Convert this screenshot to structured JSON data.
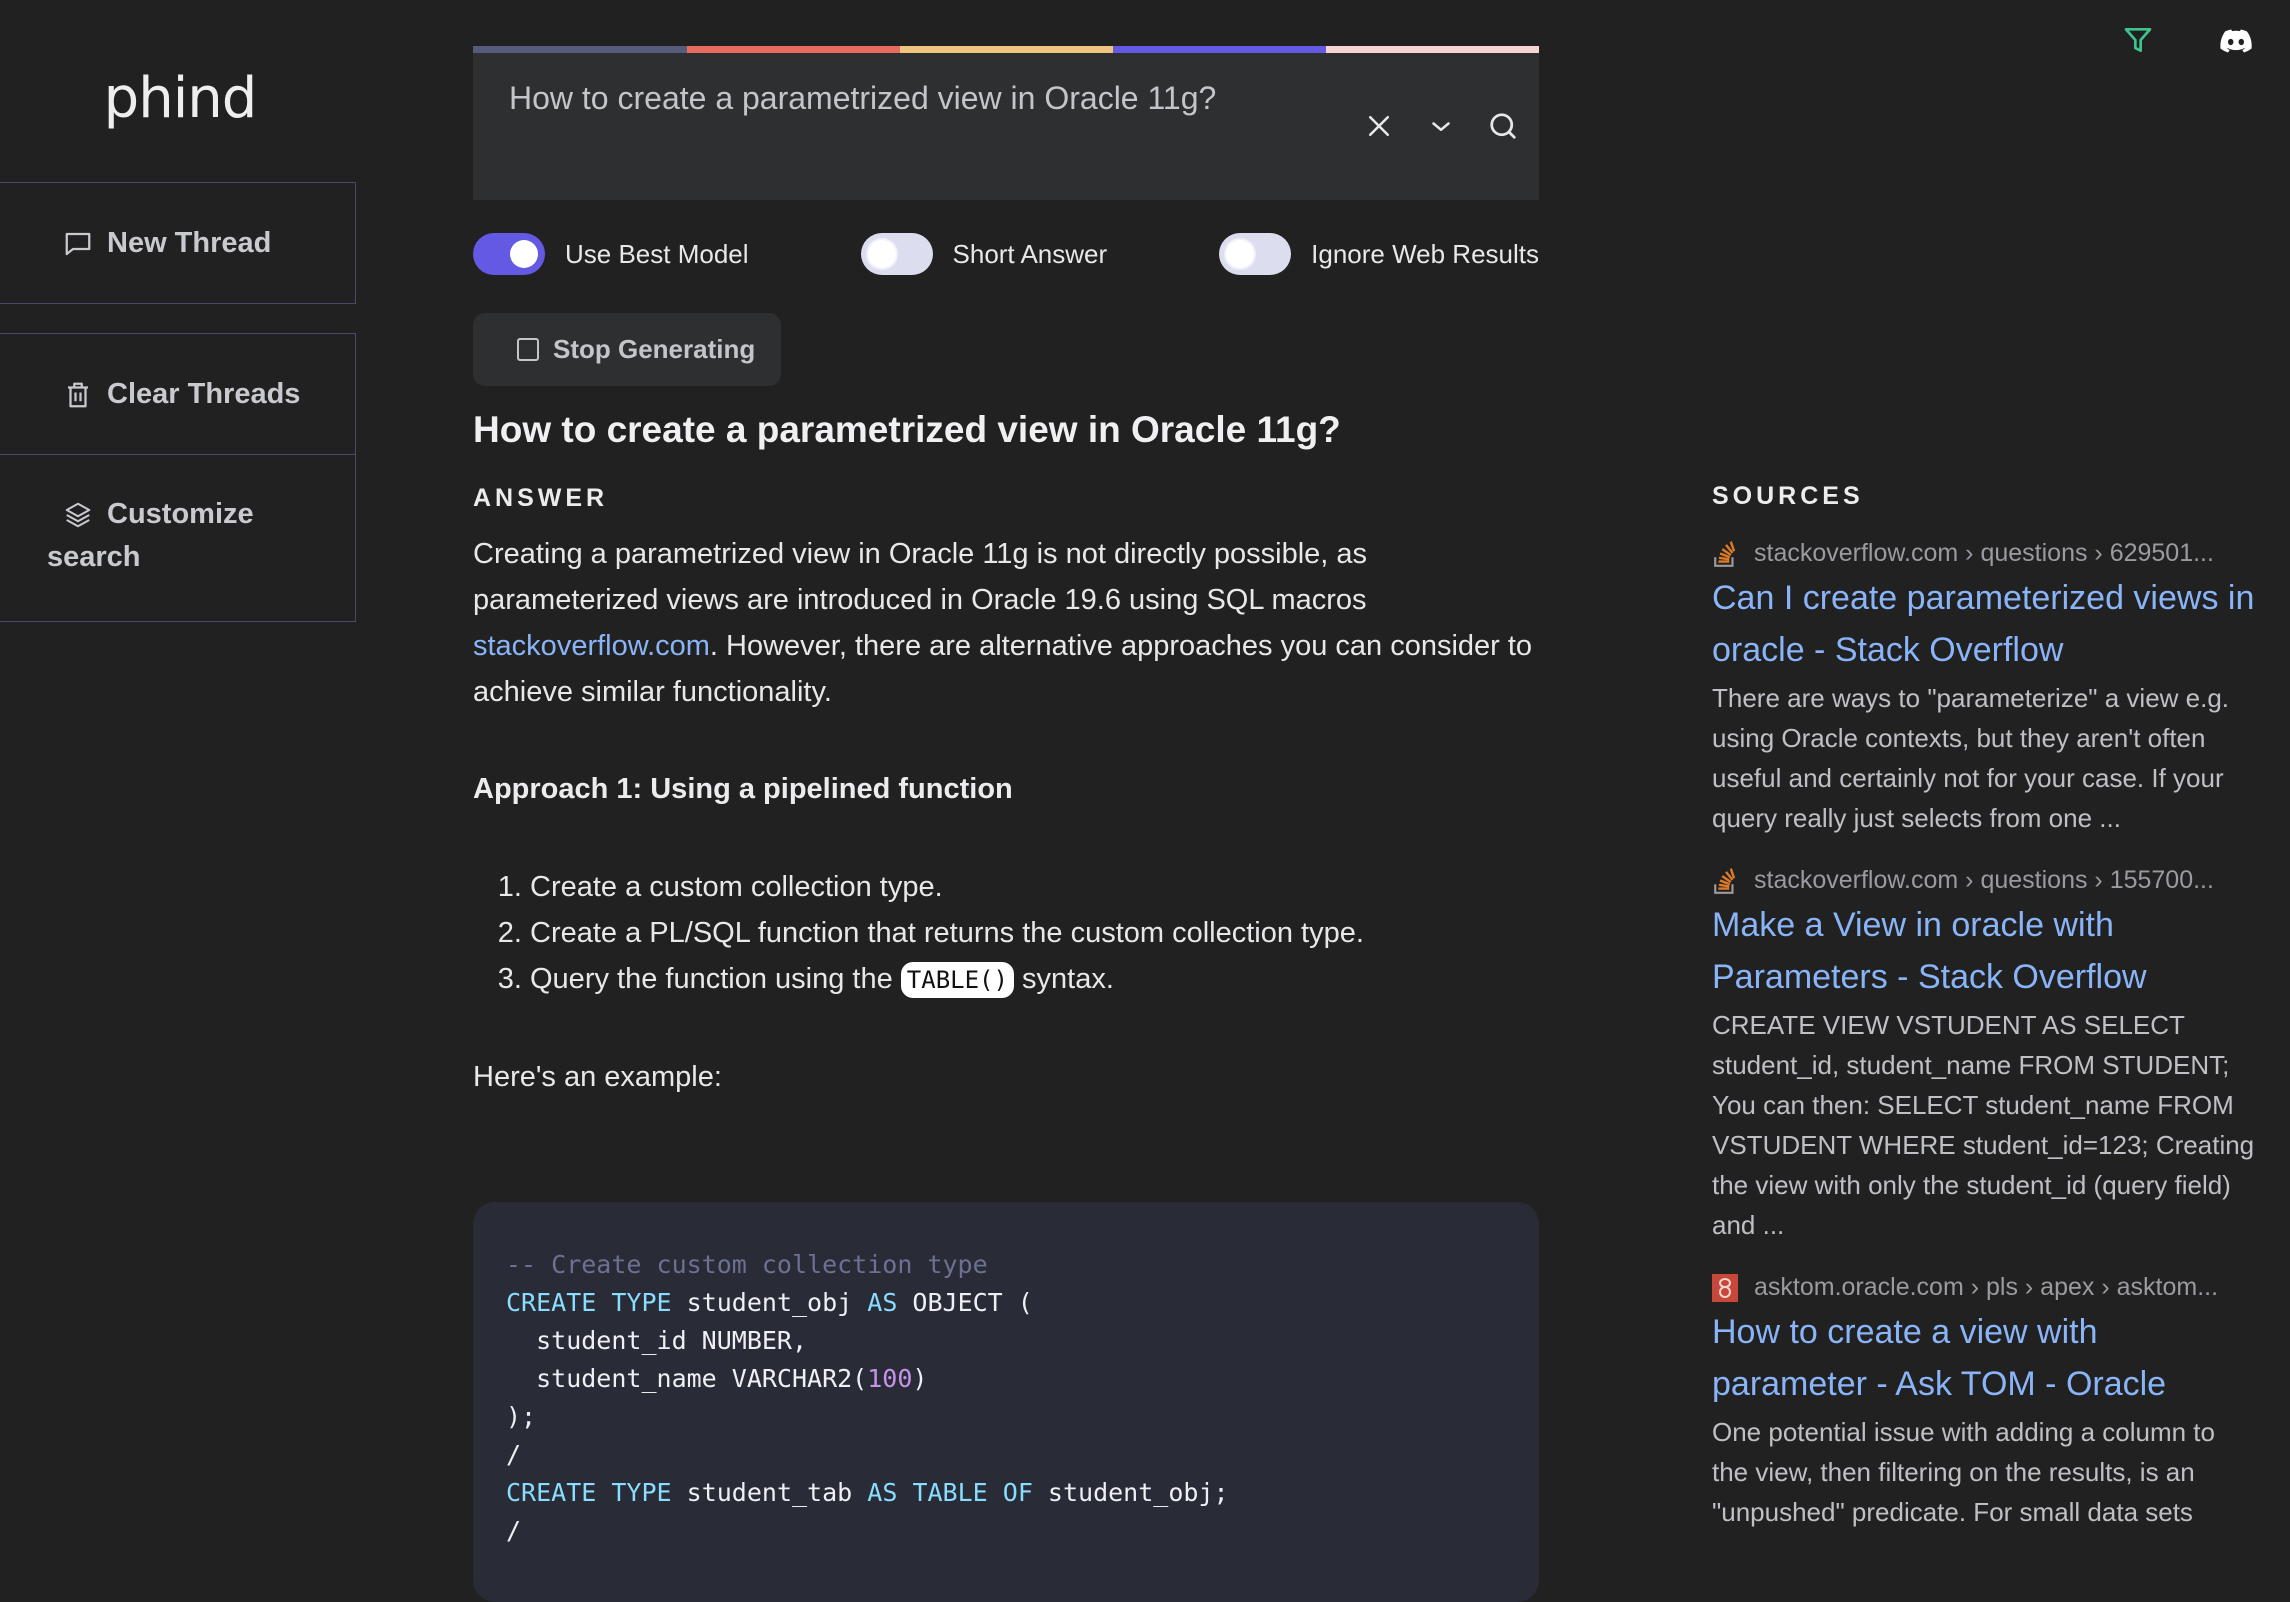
{
  "app": {
    "logo": "phind"
  },
  "sidebar": {
    "items": [
      {
        "label": "New Thread",
        "icon": "chat-bubble-icon"
      },
      {
        "label": "Clear Threads",
        "icon": "trash-icon"
      },
      {
        "label_line1": "Customize",
        "label_line2": "search",
        "icon": "layers-icon"
      }
    ]
  },
  "topbar": {
    "icons": [
      "filter-icon",
      "discord-icon"
    ],
    "filter_color": "#3ec48f"
  },
  "search": {
    "query": "How to create a parametrized view in Oracle 11g?",
    "bar_colors": [
      "#575b7b",
      "#e86b60",
      "#f0c47e",
      "#6359e3",
      "#f7d4d4"
    ],
    "icons": [
      "close-icon",
      "chevron-down-icon",
      "search-icon"
    ]
  },
  "toggles": [
    {
      "label": "Use Best Model",
      "on": true
    },
    {
      "label": "Short Answer",
      "on": false
    },
    {
      "label": "Ignore Web Results",
      "on": false
    }
  ],
  "stop_button": {
    "label": "Stop Generating"
  },
  "answer": {
    "title": "How to create a parametrized view in Oracle 11g?",
    "section_label": "ANSWER",
    "intro_before_link": "Creating a parametrized view in Oracle 11g is not directly possible, as parameterized views are introduced in Oracle 19.6 using SQL macros ",
    "intro_link": "stackoverflow.com",
    "intro_after_link": ". However, there are alternative approaches you can consider to achieve similar functionality.",
    "approach_heading": "Approach 1: Using a pipelined function",
    "steps": [
      {
        "text": "Create a custom collection type."
      },
      {
        "text": "Create a PL/SQL function that returns the custom collection type."
      },
      {
        "before": "Query the function using the ",
        "code": "TABLE()",
        "after": " syntax."
      }
    ],
    "example_label": "Here's an example:",
    "code_lines": [
      [
        {
          "t": "-- Create custom collection type",
          "c": "com"
        }
      ],
      [
        {
          "t": "CREATE",
          "c": "kw"
        },
        {
          "t": " "
        },
        {
          "t": "TYPE",
          "c": "kw"
        },
        {
          "t": " student_obj "
        },
        {
          "t": "AS",
          "c": "kw"
        },
        {
          "t": " OBJECT ("
        }
      ],
      [
        {
          "t": "  student_id NUMBER,"
        }
      ],
      [
        {
          "t": "  student_name VARCHAR2("
        },
        {
          "t": "100",
          "c": "num"
        },
        {
          "t": ")"
        }
      ],
      [
        {
          "t": ");"
        }
      ],
      [
        {
          "t": "/"
        }
      ],
      [
        {
          "t": "CREATE",
          "c": "kw"
        },
        {
          "t": " "
        },
        {
          "t": "TYPE",
          "c": "kw"
        },
        {
          "t": " student_tab "
        },
        {
          "t": "AS",
          "c": "kw"
        },
        {
          "t": " "
        },
        {
          "t": "TABLE",
          "c": "kw"
        },
        {
          "t": " "
        },
        {
          "t": "OF",
          "c": "kw"
        },
        {
          "t": " student_obj;"
        }
      ],
      [
        {
          "t": "/"
        }
      ]
    ]
  },
  "sources": {
    "heading": "SOURCES",
    "items": [
      {
        "favicon": "stackoverflow-icon",
        "url": "stackoverflow.com › questions › 629501...",
        "title": "Can I create parameterized views in oracle - Stack Overflow",
        "snippet": "There are ways to \"parameterize\" a view e.g. using Oracle contexts, but they aren't often useful and certainly not for your case. If your query really just selects from one ..."
      },
      {
        "favicon": "stackoverflow-icon",
        "url": "stackoverflow.com › questions › 155700...",
        "title": "Make a View in oracle with Parameters - Stack Overflow",
        "snippet": "CREATE VIEW VSTUDENT AS SELECT student_id, student_name FROM STUDENT; You can then: SELECT student_name FROM VSTUDENT WHERE student_id=123; Creating the view with only the student_id (query field) and ..."
      },
      {
        "favicon": "oracle-asktom-icon",
        "url": "asktom.oracle.com › pls › apex › asktom...",
        "title": "How to create a view with parameter - Ask TOM - Oracle",
        "snippet": "One potential issue with adding a column to the view, then filtering on the results, is an \"unpushed\" predicate. For small data sets"
      }
    ]
  }
}
